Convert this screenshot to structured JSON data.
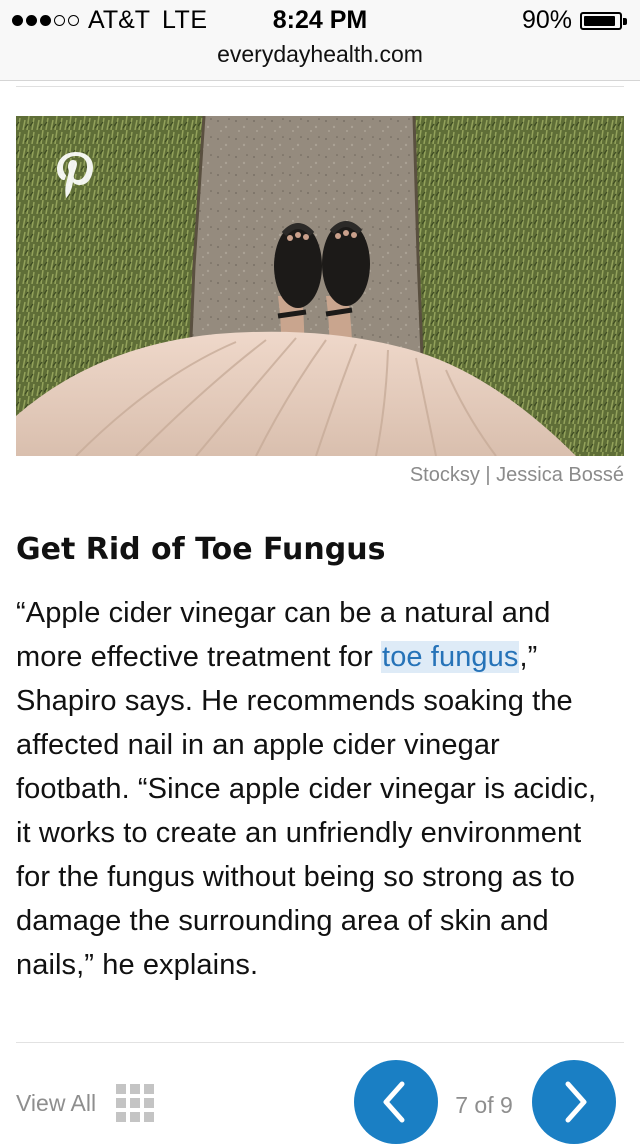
{
  "status_bar": {
    "carrier": "AT&T",
    "network": "LTE",
    "time": "8:24 PM",
    "battery_percent": "90%",
    "battery_level": 0.9,
    "signal_bars": 3,
    "signal_total": 5
  },
  "browser": {
    "url": "everydayhealth.com"
  },
  "hero": {
    "icon": "pinterest-icon",
    "credit": "Stocksy | Jessica Bossé"
  },
  "article": {
    "title": "Get Rid of Toe Fungus",
    "body_before_link": "“Apple cider vinegar can be a natural and more effective treatment for ",
    "link_text": "toe fungus",
    "body_after_link": ",” Shapiro says. He recommends soaking the affected nail in an apple cider vinegar footbath. “Since apple cider vinegar is acidic, it works to create an unfriendly environment for the fungus without being so strong as to damage the surrounding area of skin and nails,” he explains."
  },
  "pager": {
    "view_all": "View All",
    "grid_icon": "grid-icon",
    "prev_icon": "chevron-left-icon",
    "next_icon": "chevron-right-icon",
    "position": "7 of 9"
  },
  "colors": {
    "accent": "#1a7fc4",
    "link": "#2673b8",
    "link_highlight": "#deebf7",
    "muted_text": "#8e8e8e"
  }
}
